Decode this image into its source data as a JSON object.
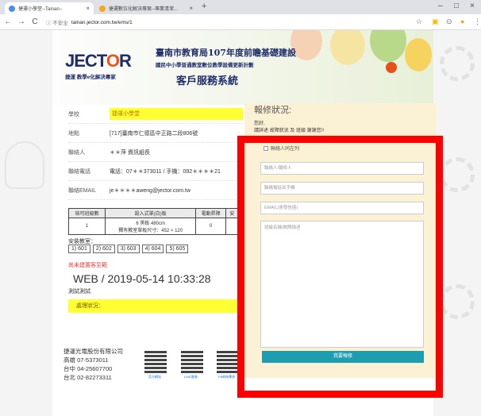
{
  "browser": {
    "tabs": [
      {
        "title": "捷運小學堂--Tainan--",
        "active": true,
        "favicon_color": "#4a8df0"
      },
      {
        "title": "捷運數位化解決專案--專業清潔...",
        "active": false,
        "favicon_color": "#f5a623"
      }
    ],
    "new_tab_glyph": "+",
    "window_controls": [
      "–",
      "□",
      "×"
    ],
    "security_label": "ⓘ 不安全",
    "url": "tainan.jector.com.tw/ems/1"
  },
  "header": {
    "logo_name_pre": "JECT",
    "logo_name_o": "O",
    "logo_name_post": "R",
    "logo_tagline": "捷運 教學e化解決專家",
    "title_line1": "臺南市教育局107年度前瞻基礎建設",
    "title_line2": "國民中小學普通教室數位教學設備更新計劃",
    "title_line3": "客戶服務系統"
  },
  "info": {
    "school_label": "學校",
    "school_value": "捷運小學堂",
    "address_label": "地點",
    "address_value": "[717]臺南市仁德區中正路二段806號",
    "contact_label": "聯絡人",
    "contact_value": "＊＊萍 資訊組長",
    "phone_label": "聯絡電話",
    "phone_value": "電話：07＊＊373011 / 手機：092＊＊＊＊21",
    "email_label": "聯絡EMAIL",
    "email_value": "je＊＊＊＊aweng@jector.com.tw"
  },
  "spec_table": {
    "headers": [
      "核可班級數",
      "設入式單(白)板",
      "電動昇降",
      "安"
    ],
    "cells": [
      "1",
      "6 黑板 480cm",
      "0",
      ""
    ],
    "cell_line2": "獨有教室單板尺寸：452 × 120"
  },
  "classes": {
    "label": "安裝教室：",
    "items": [
      "1) 601",
      "2) 602",
      "3) 603",
      "4) 604",
      "5) 605"
    ]
  },
  "note": "尚未建置客至範",
  "timestamp": "WEB / 2019-05-14 10:33:28",
  "test_text": "測試測試.",
  "status_label": "處理狀況：",
  "company": {
    "name": "捷運光電股份有限公司",
    "lines": [
      "高雄 07-5373011",
      "台中 04-25607700",
      "台北 02-82273311"
    ],
    "qr_labels": [
      "官方網站",
      "LINE客服",
      "FB粉絲專頁"
    ]
  },
  "repair_form": {
    "title": "報修狀況:",
    "greeting": "您好,",
    "instruction": "請詳述 故障狀況 及 班級 謝謝您!!",
    "same_contact_label": "聯絡人同左列",
    "contact_placeholder": "聯絡人/報修人",
    "phone_placeholder": "聯絡電話及手機",
    "email_placeholder": "EMAIL(會發信函)",
    "desc_placeholder": "班級名稱/故障描述",
    "submit_label": "我要報修"
  },
  "colors": {
    "highlight_yellow": "#ffff33",
    "form_bg": "#fbf2d5",
    "submit_teal": "#1e9cb0",
    "annotation_red": "#ff0000",
    "brand_navy": "#1f2d6b"
  }
}
